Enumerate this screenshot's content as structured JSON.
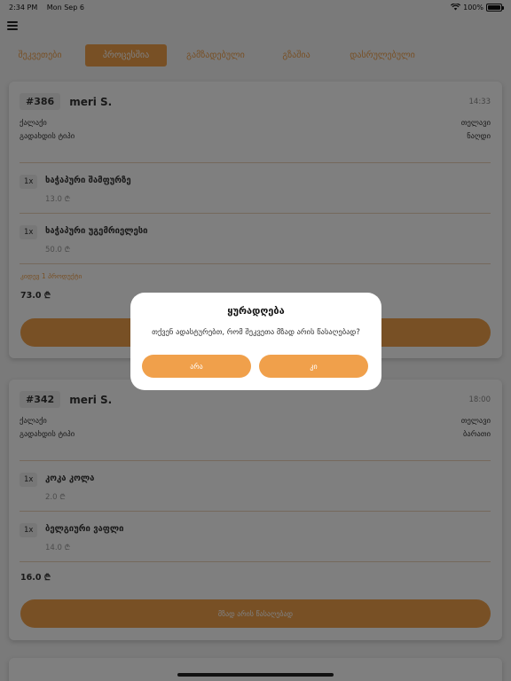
{
  "status_bar": {
    "time": "2:34 PM",
    "date": "Mon Sep 6",
    "battery": "100%",
    "battery_level": 1.0,
    "wifi_icon": "wifi-icon",
    "battery_icon": "battery-icon"
  },
  "menu_icon": "hamburger-menu-icon",
  "accent_color": "#f0a04b",
  "tabs": [
    {
      "label": "შეკვეთები",
      "active": false
    },
    {
      "label": "პროცესშია",
      "active": true
    },
    {
      "label": "გამზადებული",
      "active": false
    },
    {
      "label": "გზაშია",
      "active": false
    },
    {
      "label": "დასრულებული",
      "active": false
    }
  ],
  "orders": [
    {
      "number": "#386",
      "customer": "meri S.",
      "time": "14:33",
      "info": [
        {
          "label": "ქალაქი",
          "value": "თელავი"
        },
        {
          "label": "გადახდის ტიპი",
          "value": "ნაღდი"
        }
      ],
      "items": [
        {
          "qty": "1x",
          "name": "ხაჭაპური შამფურზე",
          "price": "13.0 ₾"
        },
        {
          "qty": "1x",
          "name": "ხაჭაპური უგემრიელესი",
          "price": "50.0 ₾"
        }
      ],
      "more_link": "კიდევ 1 პროდუქტი",
      "total": "73.0 ₾",
      "action_label": ""
    },
    {
      "number": "#342",
      "customer": "meri S.",
      "time": "18:00",
      "info": [
        {
          "label": "ქალაქი",
          "value": "თელავი"
        },
        {
          "label": "გადახდის ტიპი",
          "value": "ბარათი"
        }
      ],
      "items": [
        {
          "qty": "1x",
          "name": "კოკა კოლა",
          "price": "2.0 ₾"
        },
        {
          "qty": "1x",
          "name": "ბელგიური ვაფლი",
          "price": "14.0 ₾"
        }
      ],
      "total": "16.0 ₾",
      "action_label": "მზად არის წასაღებად"
    }
  ],
  "dialog": {
    "title": "ყურადღება",
    "message": "თქვენ ადასტურებთ, რომ შეკვეთა მზად არის წასაღებად?",
    "no_label": "არა",
    "yes_label": "კი"
  }
}
